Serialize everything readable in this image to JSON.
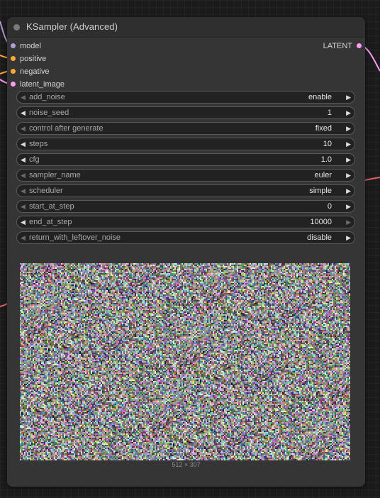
{
  "node": {
    "title": "KSampler (Advanced)",
    "inputs": [
      {
        "label": "model",
        "color": "#b39ddb"
      },
      {
        "label": "positive",
        "color": "#ffa931"
      },
      {
        "label": "negative",
        "color": "#ffa931"
      },
      {
        "label": "latent_image",
        "color": "#ff9cf9"
      }
    ],
    "outputs": [
      {
        "label": "LATENT",
        "color": "#ff9cf9"
      }
    ],
    "widgets": [
      {
        "name": "add_noise",
        "value": "enable"
      },
      {
        "name": "noise_seed",
        "value": "1"
      },
      {
        "name": "control after generate",
        "value": "fixed"
      },
      {
        "name": "steps",
        "value": "10"
      },
      {
        "name": "cfg",
        "value": "1.0"
      },
      {
        "name": "sampler_name",
        "value": "euler"
      },
      {
        "name": "scheduler",
        "value": "simple"
      },
      {
        "name": "start_at_step",
        "value": "0"
      },
      {
        "name": "end_at_step",
        "value": "10000"
      },
      {
        "name": "return_with_leftover_noise",
        "value": "disable"
      }
    ],
    "preview_size": "512 × 307"
  },
  "colors": {
    "model_link": "#b39ddb",
    "conditioning_link": "#ffa931",
    "latent_link": "#ff9cf9",
    "red_link": "#e06060"
  }
}
